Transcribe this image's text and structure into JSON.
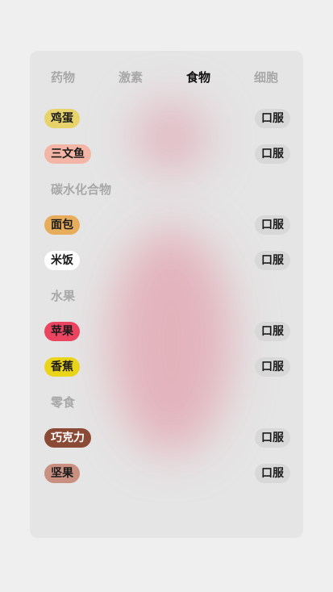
{
  "tabs": [
    {
      "label": "药物",
      "active": false
    },
    {
      "label": "激素",
      "active": false
    },
    {
      "label": "食物",
      "active": true
    },
    {
      "label": "细胞",
      "active": false
    }
  ],
  "items": [
    {
      "label": "鸡蛋",
      "color": "#e8d36a",
      "route": "口服"
    },
    {
      "label": "三文鱼",
      "color": "#f3b6a6",
      "route": "口服"
    },
    {
      "group": "碳水化合物"
    },
    {
      "label": "面包",
      "color": "#e8ad5c",
      "route": "口服"
    },
    {
      "label": "米饭",
      "color": "#ffffff",
      "route": "口服"
    },
    {
      "group": "水果"
    },
    {
      "label": "苹果",
      "color": "#ea4460",
      "route": "口服"
    },
    {
      "label": "香蕉",
      "color": "#ead51a",
      "route": "口服"
    },
    {
      "group": "零食"
    },
    {
      "label": "巧克力",
      "color": "#8a4a35",
      "route": "口服",
      "light_text": true
    },
    {
      "label": "坚果",
      "color": "#c99082",
      "route": "口服"
    }
  ]
}
